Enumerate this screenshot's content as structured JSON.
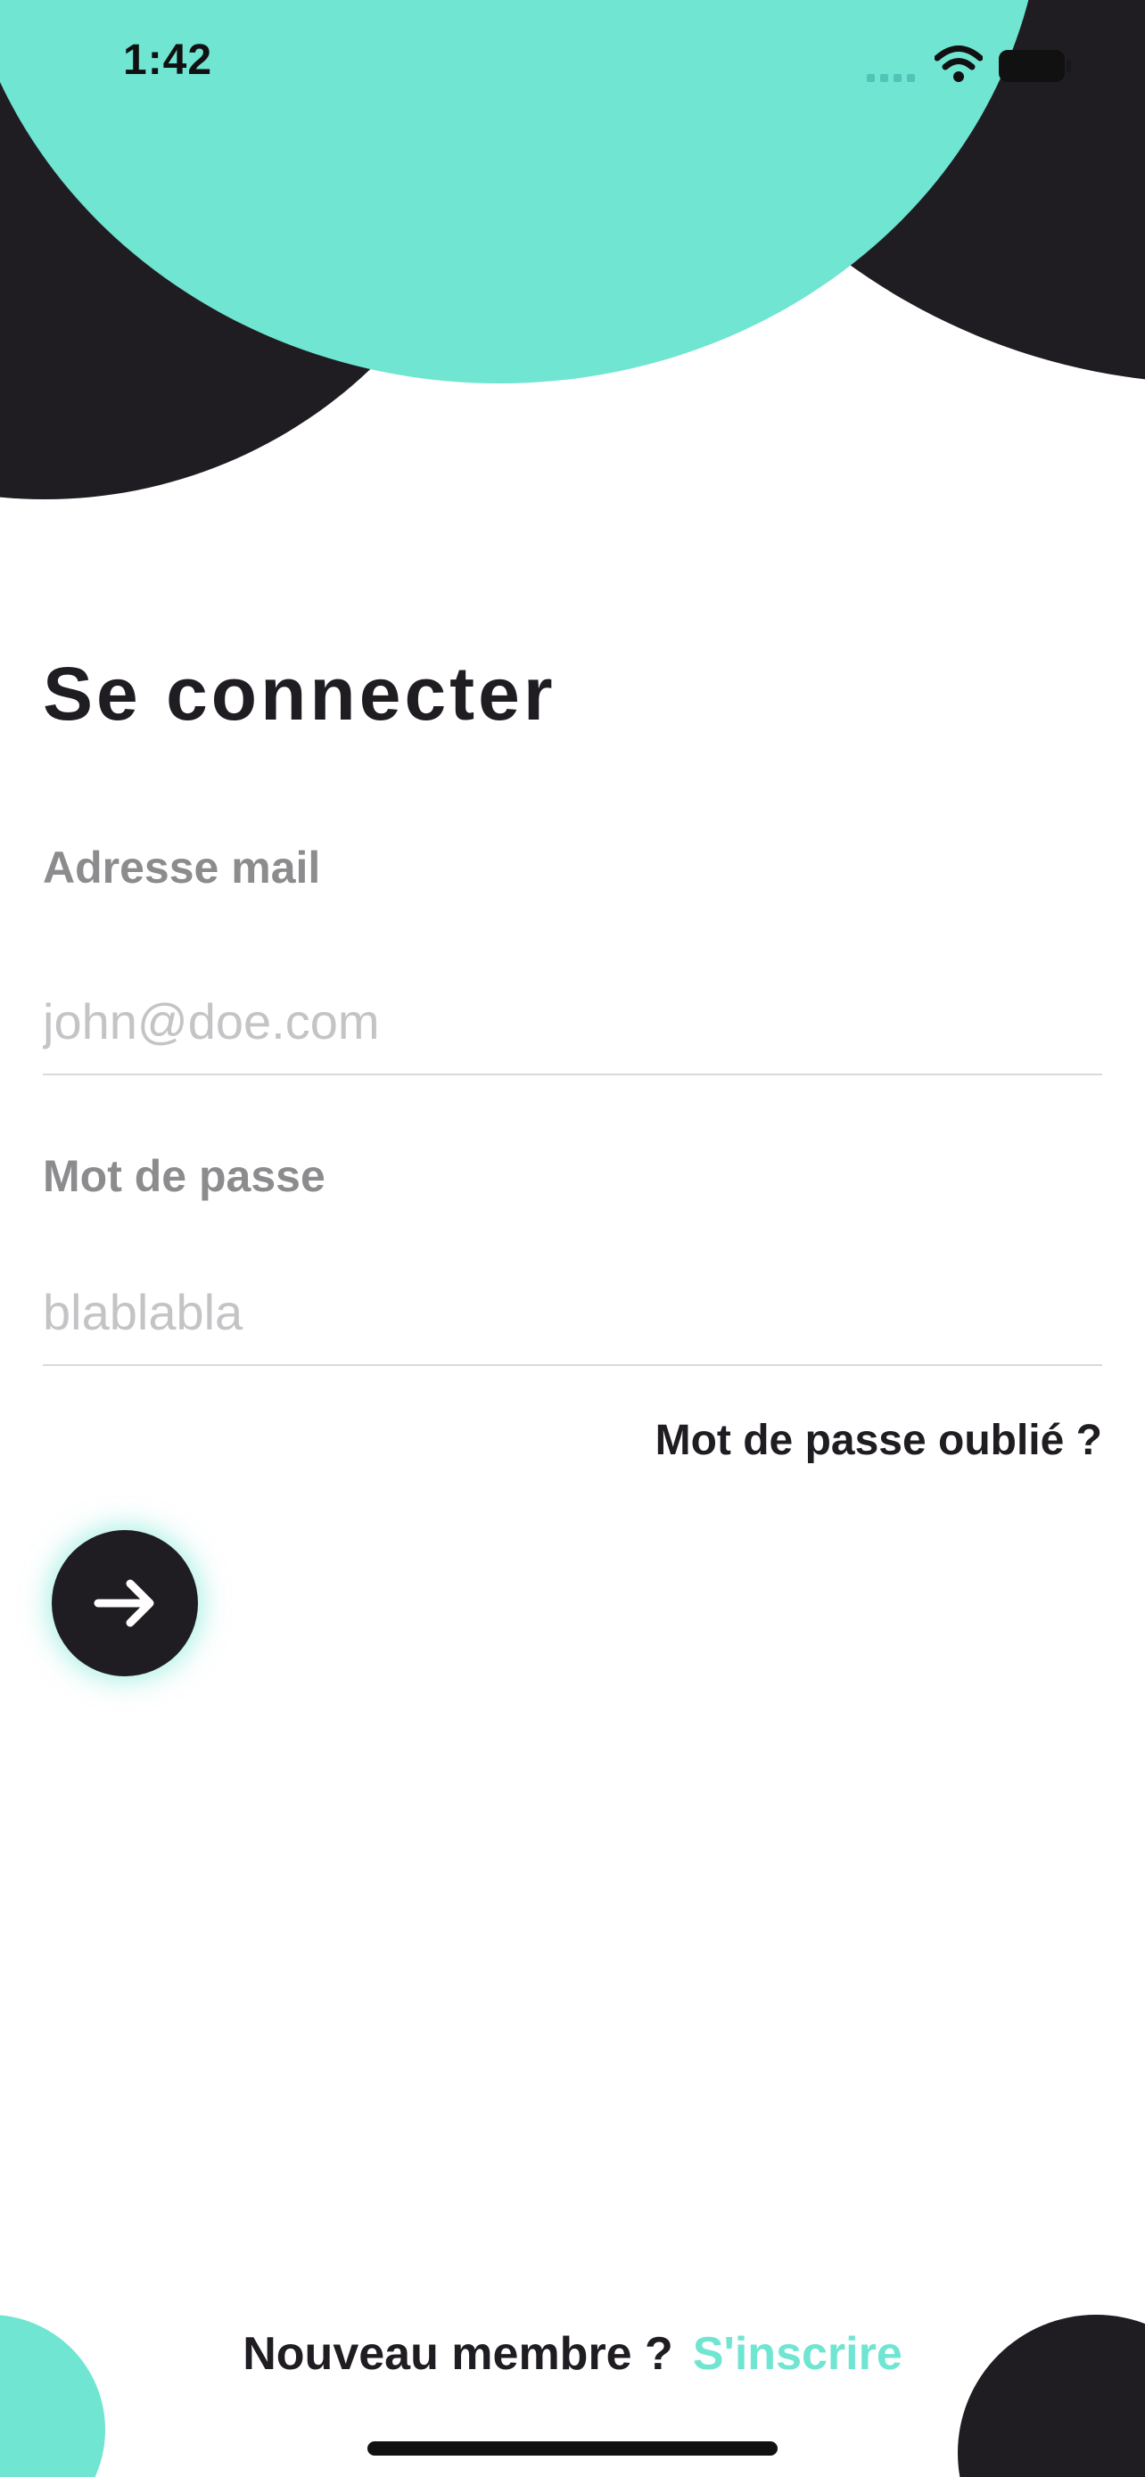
{
  "status_bar": {
    "time": "1:42",
    "icons": [
      "signal-icon",
      "wifi-icon",
      "battery-icon"
    ]
  },
  "login": {
    "title": "Se connecter",
    "email": {
      "label": "Adresse mail",
      "value": "",
      "placeholder": "john@doe.com"
    },
    "password": {
      "label": "Mot de passe",
      "value": "",
      "placeholder": "blablabla"
    },
    "forgot_label": "Mot de passe oublié ?",
    "submit_icon": "arrow-right-icon"
  },
  "footer": {
    "question": "Nouveau membre ?",
    "signup_label": "S'inscrire"
  },
  "colors": {
    "accent": "#6fe5d2",
    "dark": "#201d22",
    "label": "#8c8c8e",
    "placeholder": "#c4c4c6"
  }
}
